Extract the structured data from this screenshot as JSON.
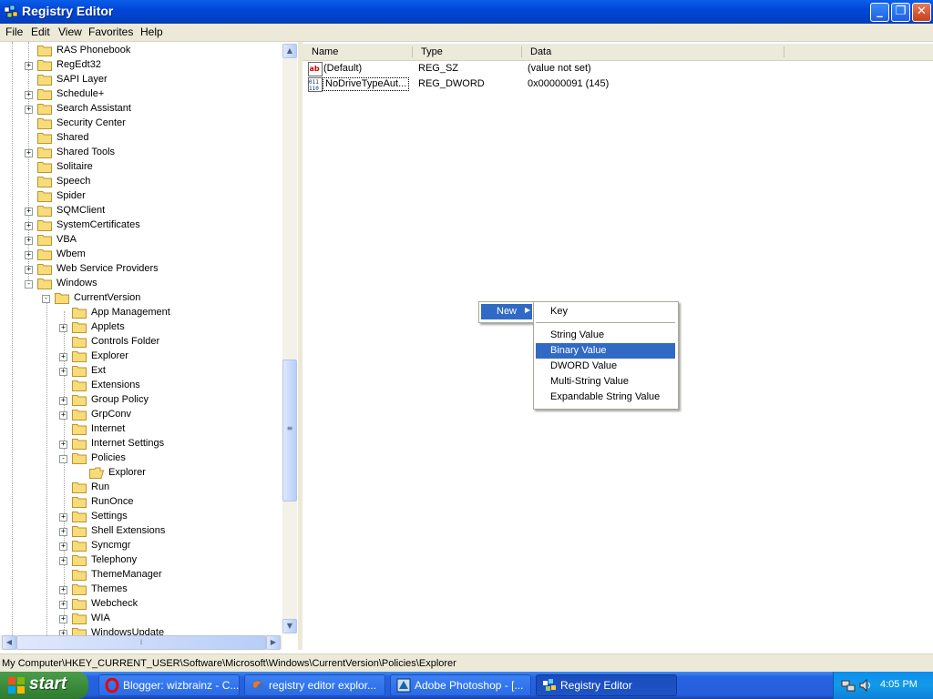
{
  "window": {
    "title": "Registry Editor"
  },
  "menubar": [
    "File",
    "Edit",
    "View",
    "Favorites",
    "Help"
  ],
  "tree": [
    {
      "label": "RAS Phonebook",
      "level": 2,
      "expander": ""
    },
    {
      "label": "RegEdt32",
      "level": 2,
      "expander": "+"
    },
    {
      "label": "SAPI Layer",
      "level": 2,
      "expander": ""
    },
    {
      "label": "Schedule+",
      "level": 2,
      "expander": "+"
    },
    {
      "label": "Search Assistant",
      "level": 2,
      "expander": "+"
    },
    {
      "label": "Security Center",
      "level": 2,
      "expander": ""
    },
    {
      "label": "Shared",
      "level": 2,
      "expander": ""
    },
    {
      "label": "Shared Tools",
      "level": 2,
      "expander": "+"
    },
    {
      "label": "Solitaire",
      "level": 2,
      "expander": ""
    },
    {
      "label": "Speech",
      "level": 2,
      "expander": ""
    },
    {
      "label": "Spider",
      "level": 2,
      "expander": ""
    },
    {
      "label": "SQMClient",
      "level": 2,
      "expander": "+"
    },
    {
      "label": "SystemCertificates",
      "level": 2,
      "expander": "+"
    },
    {
      "label": "VBA",
      "level": 2,
      "expander": "+"
    },
    {
      "label": "Wbem",
      "level": 2,
      "expander": "+"
    },
    {
      "label": "Web Service Providers",
      "level": 2,
      "expander": "+"
    },
    {
      "label": "Windows",
      "level": 2,
      "expander": "-"
    },
    {
      "label": "CurrentVersion",
      "level": 3,
      "expander": "-"
    },
    {
      "label": "App Management",
      "level": 4,
      "expander": ""
    },
    {
      "label": "Applets",
      "level": 4,
      "expander": "+"
    },
    {
      "label": "Controls Folder",
      "level": 4,
      "expander": ""
    },
    {
      "label": "Explorer",
      "level": 4,
      "expander": "+"
    },
    {
      "label": "Ext",
      "level": 4,
      "expander": "+"
    },
    {
      "label": "Extensions",
      "level": 4,
      "expander": ""
    },
    {
      "label": "Group Policy",
      "level": 4,
      "expander": "+"
    },
    {
      "label": "GrpConv",
      "level": 4,
      "expander": "+"
    },
    {
      "label": "Internet",
      "level": 4,
      "expander": ""
    },
    {
      "label": "Internet Settings",
      "level": 4,
      "expander": "+"
    },
    {
      "label": "Policies",
      "level": 4,
      "expander": "-"
    },
    {
      "label": "Explorer",
      "level": 5,
      "expander": "",
      "open": true
    },
    {
      "label": "Run",
      "level": 4,
      "expander": ""
    },
    {
      "label": "RunOnce",
      "level": 4,
      "expander": ""
    },
    {
      "label": "Settings",
      "level": 4,
      "expander": "+"
    },
    {
      "label": "Shell Extensions",
      "level": 4,
      "expander": "+"
    },
    {
      "label": "Syncmgr",
      "level": 4,
      "expander": "+"
    },
    {
      "label": "Telephony",
      "level": 4,
      "expander": "+"
    },
    {
      "label": "ThemeManager",
      "level": 4,
      "expander": ""
    },
    {
      "label": "Themes",
      "level": 4,
      "expander": "+"
    },
    {
      "label": "Webcheck",
      "level": 4,
      "expander": "+"
    },
    {
      "label": "WIA",
      "level": 4,
      "expander": "+"
    },
    {
      "label": "WindowsUpdate",
      "level": 4,
      "expander": "+"
    }
  ],
  "list": {
    "columns": [
      "Name",
      "Type",
      "Data"
    ],
    "rows": [
      {
        "name": "(Default)",
        "type": "REG_SZ",
        "data": "(value not set)",
        "icon": "string-value-icon"
      },
      {
        "name": "NoDriveTypeAut...",
        "type": "REG_DWORD",
        "data": "0x00000091 (145)",
        "icon": "binary-value-icon"
      }
    ]
  },
  "context_menu": {
    "new_label": "New",
    "submenu": [
      "Key",
      "String Value",
      "Binary Value",
      "DWORD Value",
      "Multi-String Value",
      "Expandable String Value"
    ],
    "highlighted": "Binary Value"
  },
  "statusbar": {
    "path": "My Computer\\HKEY_CURRENT_USER\\Software\\Microsoft\\Windows\\CurrentVersion\\Policies\\Explorer"
  },
  "taskbar": {
    "start_label": "start",
    "buttons": [
      {
        "label": "Blogger: wizbrainz - C...",
        "icon": "opera-icon"
      },
      {
        "label": "registry editor explor...",
        "icon": "firefox-icon"
      },
      {
        "label": "Adobe Photoshop - [...",
        "icon": "photoshop-icon"
      },
      {
        "label": "Registry Editor",
        "icon": "regedit-icon",
        "active": true
      }
    ],
    "clock": "4:05 PM"
  },
  "colors": {
    "selection": "#316ac5",
    "titlebar": "#0046d8",
    "taskbar": "#245edb",
    "start": "#3c8c3c"
  }
}
